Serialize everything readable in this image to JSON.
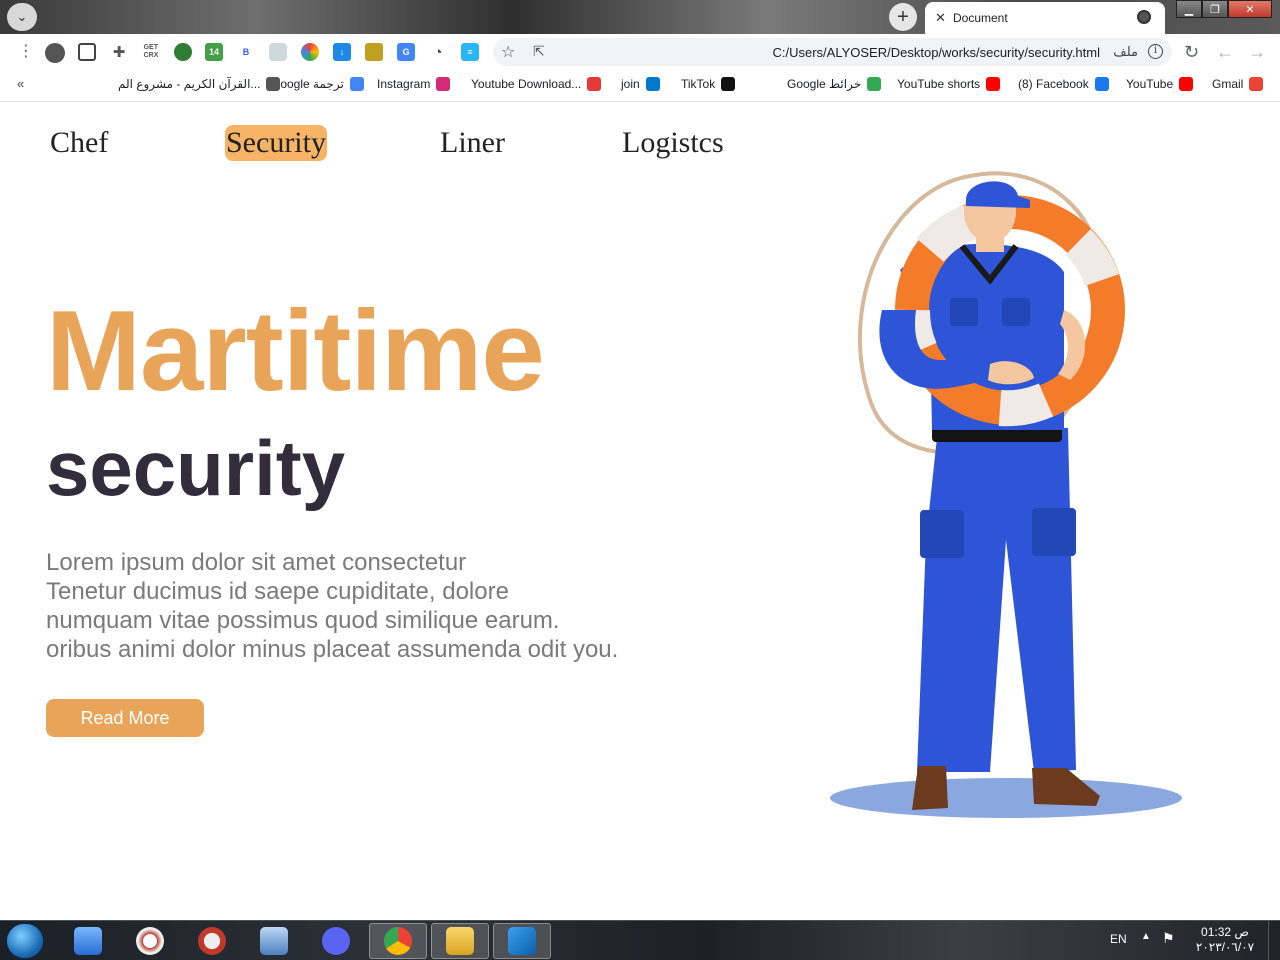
{
  "browser": {
    "tab": {
      "title": "Document"
    },
    "address": {
      "url": "C:/Users/ALYOSER/Desktop/works/security/security.html",
      "scheme_label": "ملف"
    },
    "bookmarks": [
      {
        "label": "Gmail",
        "icon": "gmail-icon",
        "color": "#ea4335"
      },
      {
        "label": "YouTube",
        "icon": "youtube-icon",
        "color": "#ff0000"
      },
      {
        "label": "(8) Facebook",
        "icon": "facebook-icon",
        "color": "#1877f2"
      },
      {
        "label": "YouTube shorts",
        "icon": "youtube-icon",
        "color": "#ff0000"
      },
      {
        "label": "Google خرائط",
        "icon": "maps-icon",
        "color": "#34a853"
      },
      {
        "label": "TikTok",
        "icon": "tiktok-icon",
        "color": "#111111"
      },
      {
        "label": "join",
        "icon": "vscode-icon",
        "color": "#007acc"
      },
      {
        "label": "Youtube Download...",
        "icon": "download-icon",
        "color": "#e53935"
      },
      {
        "label": "Instagram",
        "icon": "instagram-icon",
        "color": "#d62976"
      },
      {
        "label": "Google ترجمة",
        "icon": "translate-icon",
        "color": "#4285f4"
      },
      {
        "label": "القرآن الكريم - مشروع الم...",
        "icon": "globe-icon",
        "color": "#555555"
      }
    ]
  },
  "page": {
    "nav": [
      {
        "label": "Chef",
        "active": false
      },
      {
        "label": "Security",
        "active": true
      },
      {
        "label": "Liner",
        "active": false
      },
      {
        "label": "Logistcs",
        "active": false
      }
    ],
    "hero": {
      "title_line1": "Martitime",
      "title_line2": "security",
      "paragraph": [
        "Lorem ipsum dolor sit amet consectetur",
        "Tenetur ducimus id saepe cupiditate, dolore",
        "numquam vitae possimus quod similique earum.",
        "oribus animi dolor minus placeat assumenda odit you."
      ],
      "button_label": "Read More"
    },
    "colors": {
      "accent": "#e8a559",
      "nav_active_bg": "#f7b466",
      "title_dark": "#332d3b",
      "text_gray": "#7a7a7a"
    }
  },
  "taskbar": {
    "language": "EN",
    "clock_time": "01:32 ص",
    "clock_date": "٢٠٢٣/٠٦/٠٧",
    "apps": [
      "control-panel-icon",
      "compass-icon",
      "snipping-tool-icon",
      "computer-icon",
      "discord-icon",
      "chrome-icon",
      "file-explorer-icon",
      "vscode-icon"
    ]
  }
}
